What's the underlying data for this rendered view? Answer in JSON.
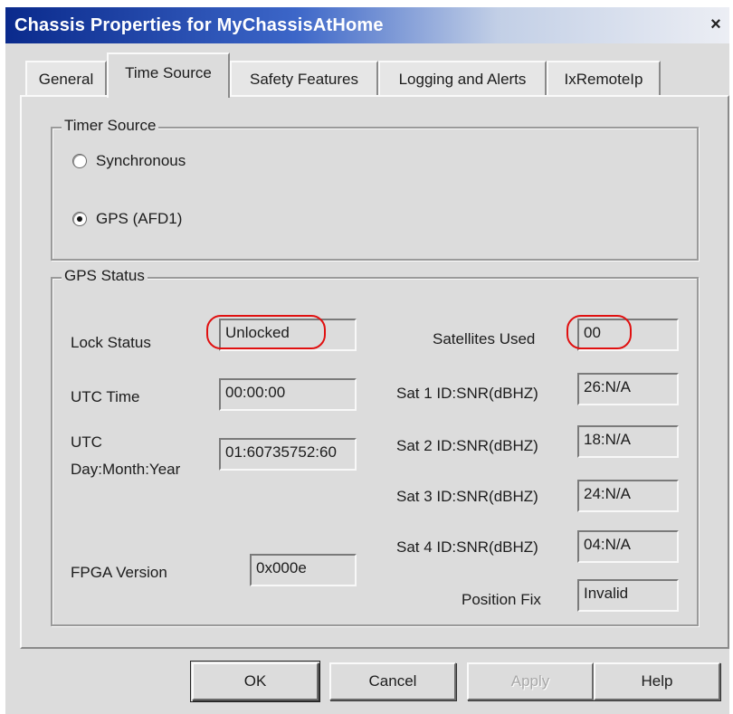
{
  "window": {
    "title": "Chassis Properties for MyChassisAtHome",
    "close_glyph": "×"
  },
  "tabs": [
    {
      "label": "General",
      "active": false
    },
    {
      "label": "Time Source",
      "active": true
    },
    {
      "label": "Safety Features",
      "active": false
    },
    {
      "label": "Logging and Alerts",
      "active": false
    },
    {
      "label": "IxRemoteIp",
      "active": false
    }
  ],
  "timer_source": {
    "legend": "Timer Source",
    "options": [
      {
        "label": "Synchronous",
        "checked": false
      },
      {
        "label": "GPS (AFD1)",
        "checked": true
      }
    ]
  },
  "gps_status": {
    "legend": "GPS Status",
    "lock_status": {
      "label": "Lock Status",
      "value": "Unlocked"
    },
    "utc_time": {
      "label": "UTC Time",
      "value": "00:00:00"
    },
    "utc_date": {
      "label_line1": "UTC",
      "label_line2": "Day:Month:Year",
      "value": "01:60735752:60"
    },
    "fpga_version": {
      "label": "FPGA Version",
      "value": "0x000e"
    },
    "satellites_used": {
      "label": "Satellites Used",
      "value": "00"
    },
    "sats": [
      {
        "label": "Sat 1 ID:SNR(dBHZ)",
        "value": "26:N/A"
      },
      {
        "label": "Sat 2 ID:SNR(dBHZ)",
        "value": "18:N/A"
      },
      {
        "label": "Sat 3 ID:SNR(dBHZ)",
        "value": "24:N/A"
      },
      {
        "label": "Sat 4 ID:SNR(dBHZ)",
        "value": "04:N/A"
      }
    ],
    "position_fix": {
      "label": "Position Fix",
      "value": "Invalid"
    }
  },
  "buttons": {
    "ok": "OK",
    "cancel": "Cancel",
    "apply": "Apply",
    "help": "Help"
  },
  "colors": {
    "title_bar_start": "#0a2a8c",
    "dialog_face": "#dcdcdc",
    "highlight_annotation": "#e01010"
  }
}
